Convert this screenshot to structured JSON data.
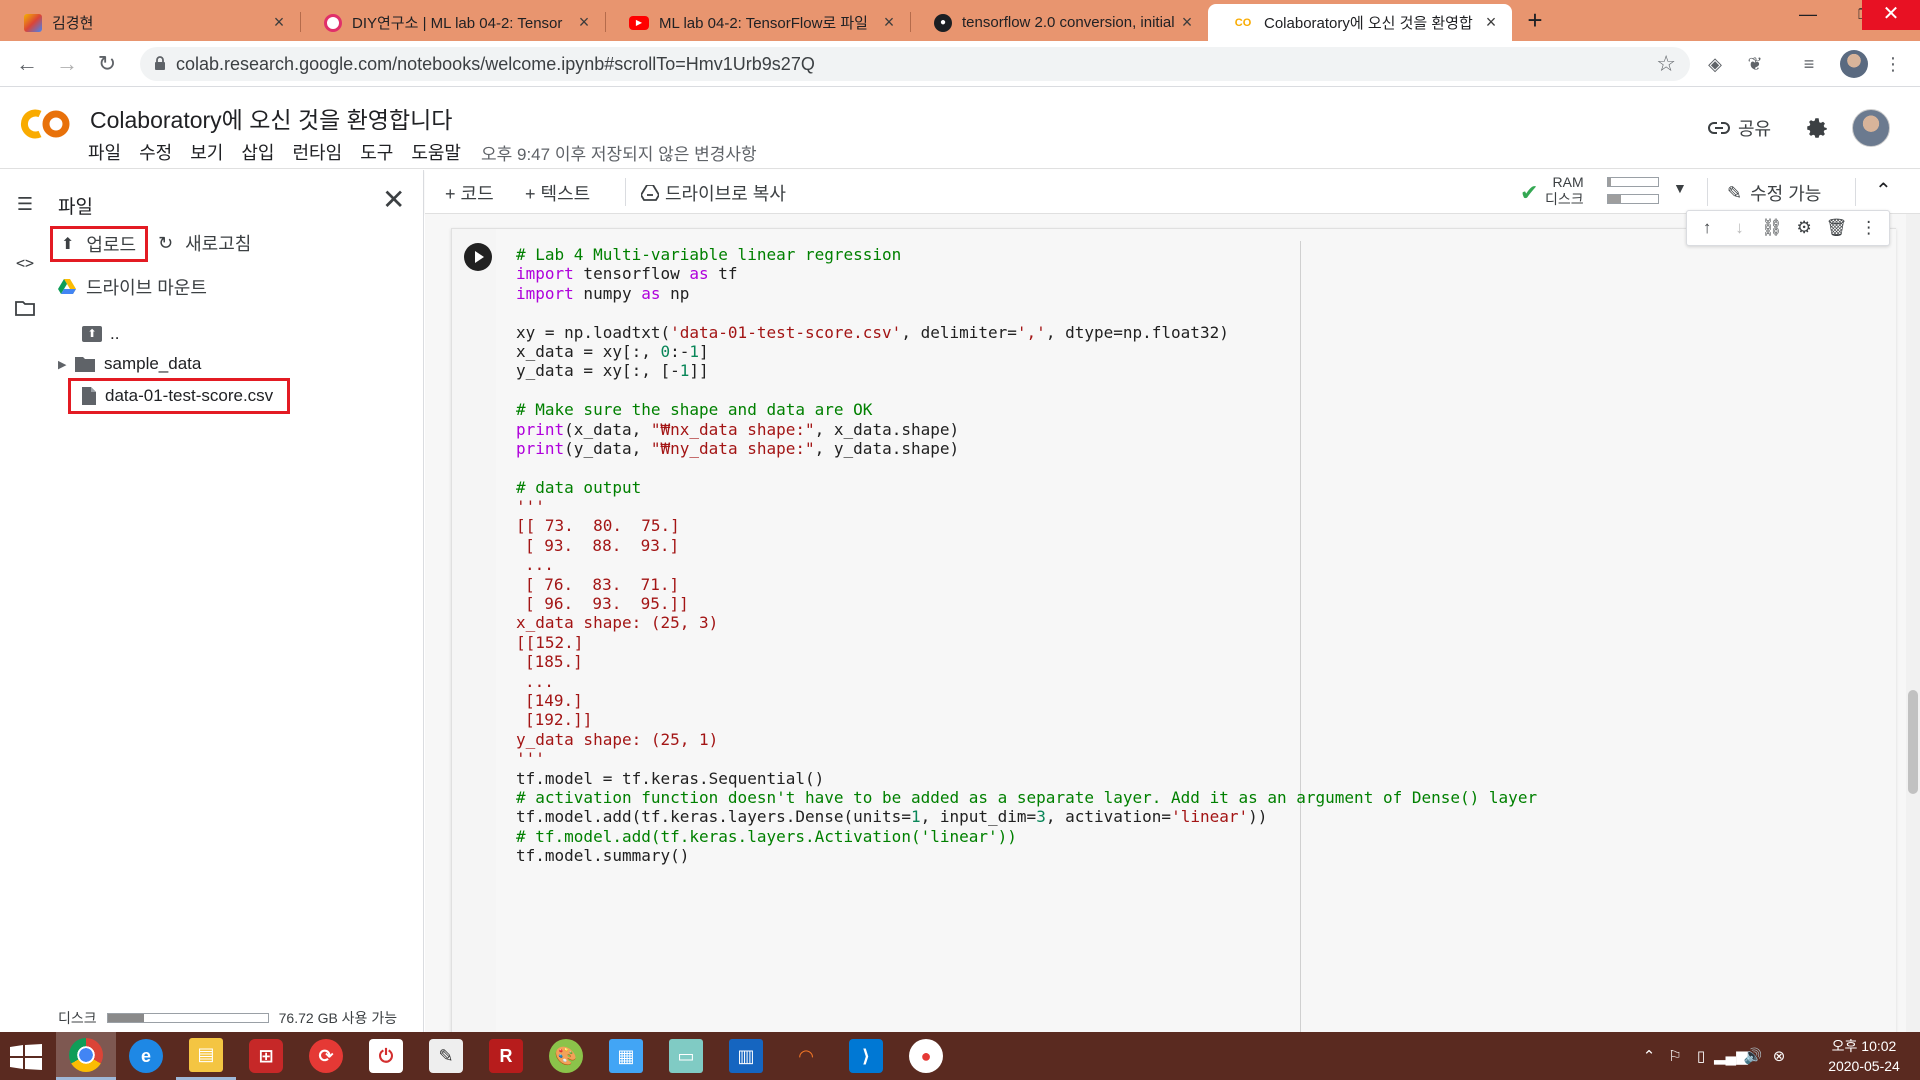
{
  "browser": {
    "tabs": [
      {
        "title": "김경현",
        "favicon": "profile-favicon"
      },
      {
        "title": "DIY연구소 | ML lab 04-2: Tensor",
        "favicon": "diy-favicon"
      },
      {
        "title": "ML lab 04-2: TensorFlow로 파일",
        "favicon": "youtube-favicon"
      },
      {
        "title": "tensorflow 2.0 conversion, initial",
        "favicon": "github-favicon"
      },
      {
        "title": "Colaboratory에 오신 것을 환영합",
        "favicon": "colab-favicon"
      }
    ],
    "address": "colab.research.google.com/notebooks/welcome.ipynb#scrollTo=Hmv1Urb9s27Q"
  },
  "colab": {
    "title": "Colaboratory에 오신 것을 환영합니다",
    "menu": [
      "파일",
      "수정",
      "보기",
      "삽입",
      "런타임",
      "도구",
      "도움말"
    ],
    "save_status": "오후 9:47 이후 저장되지 않은 변경사항",
    "share_label": "공유",
    "toolbar": {
      "add_code": "+ 코드",
      "add_text": "+ 텍스트",
      "copy_to_drive": "드라이브로 복사",
      "ram_label": "RAM",
      "disk_label": "디스크",
      "edit_label": "수정 가능"
    },
    "ram_usage": 0.06,
    "disk_usage_toolbar": 0.25
  },
  "files_pane": {
    "title": "파일",
    "upload_label": "업로드",
    "refresh_label": "새로고침",
    "mount_label": "드라이브 마운트",
    "parent_label": "..",
    "folder_label": "sample_data",
    "file_label": "data-01-test-score.csv",
    "disk_label": "디스크",
    "disk_free": "76.72 GB 사용 가능",
    "disk_usage": 0.23
  },
  "code_lines": [
    [
      [
        "# Lab 4 Multi-variable linear regression",
        "cm"
      ]
    ],
    [
      [
        "import",
        "kw"
      ],
      [
        " tensorflow ",
        ""
      ],
      [
        "as",
        "kw"
      ],
      [
        " tf",
        ""
      ]
    ],
    [
      [
        "import",
        "kw"
      ],
      [
        " numpy ",
        ""
      ],
      [
        "as",
        "kw"
      ],
      [
        " np",
        ""
      ]
    ],
    [],
    [
      [
        "xy = np.loadtxt(",
        ""
      ],
      [
        "'data-01-test-score.csv'",
        "st"
      ],
      [
        ", delimiter=",
        ""
      ],
      [
        "','",
        "st"
      ],
      [
        ", dtype=np.float32)",
        ""
      ]
    ],
    [
      [
        "x_data = xy[:, ",
        ""
      ],
      [
        "0",
        "nm"
      ],
      [
        ":-",
        ""
      ],
      [
        "1",
        "nm"
      ],
      [
        "]",
        ""
      ]
    ],
    [
      [
        "y_data = xy[:, [-",
        ""
      ],
      [
        "1",
        "nm"
      ],
      [
        "]]",
        ""
      ]
    ],
    [],
    [
      [
        "# Make sure the shape and data are OK",
        "cm"
      ]
    ],
    [
      [
        "print",
        "kw"
      ],
      [
        "(x_data, ",
        ""
      ],
      [
        "\"₩nx_data shape:\"",
        "st"
      ],
      [
        ", x_data.shape)",
        ""
      ]
    ],
    [
      [
        "print",
        "kw"
      ],
      [
        "(y_data, ",
        ""
      ],
      [
        "\"₩ny_data shape:\"",
        "st"
      ],
      [
        ", y_data.shape)",
        ""
      ]
    ],
    [],
    [
      [
        "# data output",
        "cm"
      ]
    ],
    [
      [
        "'''",
        "st"
      ]
    ],
    [
      [
        "[[ 73.  80.  75.]",
        "st"
      ]
    ],
    [
      [
        "[ 93.  88.  93.]",
        "st"
      ]
    ],
    [
      [
        "...",
        "st"
      ]
    ],
    [
      [
        "[ 76.  83.  71.]",
        "st"
      ]
    ],
    [
      [
        "[ 96.  93.  95.]]",
        "st"
      ]
    ],
    [
      [
        "x_data shape: (25, 3)",
        "st"
      ]
    ],
    [
      [
        "[[152.]",
        "st"
      ]
    ],
    [
      [
        "[185.]",
        "st"
      ]
    ],
    [
      [
        "...",
        "st"
      ]
    ],
    [
      [
        "[149.]",
        "st"
      ]
    ],
    [
      [
        "[192.]]",
        "st"
      ]
    ],
    [
      [
        "y_data shape: (25, 1)",
        "st"
      ]
    ],
    [
      [
        "'''",
        "st"
      ]
    ],
    [
      [
        "tf.model = tf.keras.Sequential()",
        ""
      ]
    ],
    [
      [
        "# activation function doesn't have to be added as a separate layer. Add it as an argument of Dense() layer",
        "cm"
      ]
    ],
    [
      [
        "tf.model.add(tf.keras.layers.Dense(units=",
        ""
      ],
      [
        "1",
        "nm"
      ],
      [
        ", input_dim=",
        ""
      ],
      [
        "3",
        "nm"
      ],
      [
        ", activation=",
        ""
      ],
      [
        "'linear'",
        "st"
      ],
      [
        "))",
        ""
      ]
    ],
    [
      [
        "# tf.model.add(tf.keras.layers.Activation('linear'))",
        "cm"
      ]
    ],
    [
      [
        "tf.model.summary()",
        ""
      ]
    ]
  ],
  "taskbar": {
    "apps": [
      "chrome",
      "internet-explorer",
      "file-explorer",
      "app-red-pink",
      "sync-app",
      "power-app",
      "inkscape-app",
      "r-app",
      "paint-app",
      "calculator-app",
      "notes-app",
      "notebook-app",
      "jupyter-app",
      "vscode-app",
      "record-app"
    ],
    "clock_time": "오후 10:02",
    "clock_date": "2020-05-24"
  }
}
